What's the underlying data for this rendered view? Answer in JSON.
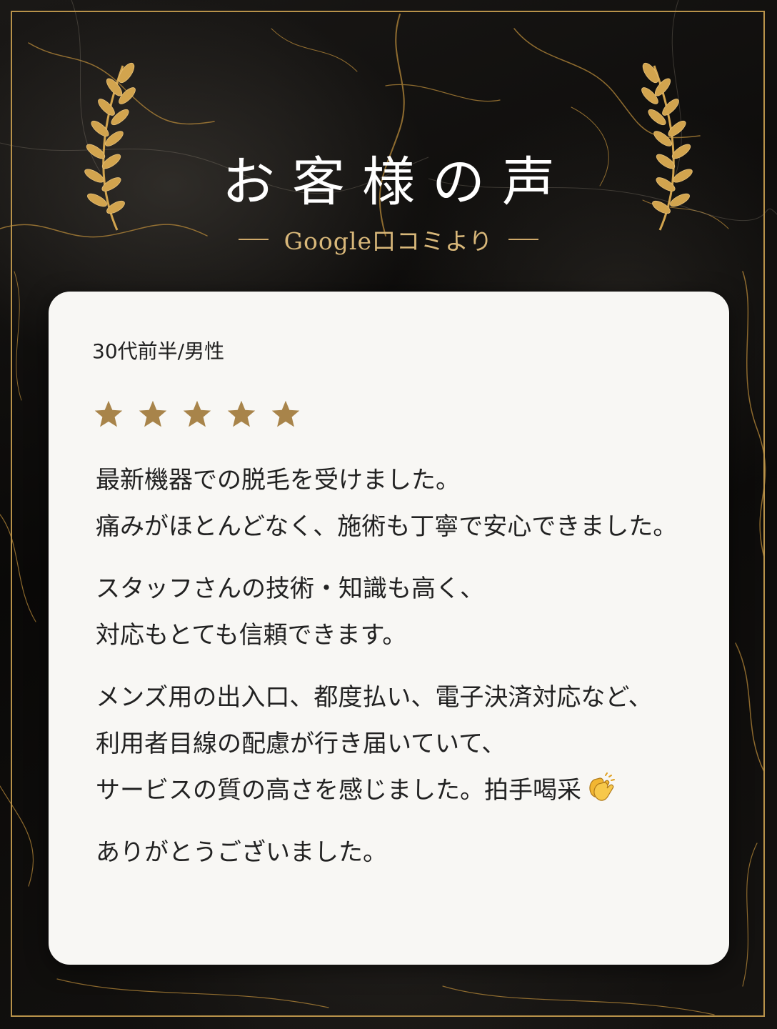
{
  "header": {
    "title": "お客様の声",
    "subtitle": "Google口コミより"
  },
  "review": {
    "reviewer": "30代前半/男性",
    "rating": 5,
    "rating_max": 5,
    "paragraphs": [
      [
        "最新機器での脱毛を受けました。",
        "痛みがほとんどなく、施術も丁寧で安心できました。"
      ],
      [
        "スタッフさんの技術・知識も高く、",
        "対応もとても信頼できます。"
      ],
      [
        "メンズ用の出入口、都度払い、電子決済対応など、",
        "利用者目線の配慮が行き届いていて、",
        "サービスの質の高さを感じました。拍手喝采"
      ],
      [
        "ありがとうございました。"
      ]
    ]
  },
  "icons": {
    "laurel": "laurel-branch-icon",
    "star": "star-icon",
    "clap": "clapping-hands-emoji"
  },
  "colors": {
    "gold": "#b8924a",
    "star": "#a8844a",
    "card": "#f8f7f4",
    "text": "#222222",
    "title": "#ffffff"
  }
}
